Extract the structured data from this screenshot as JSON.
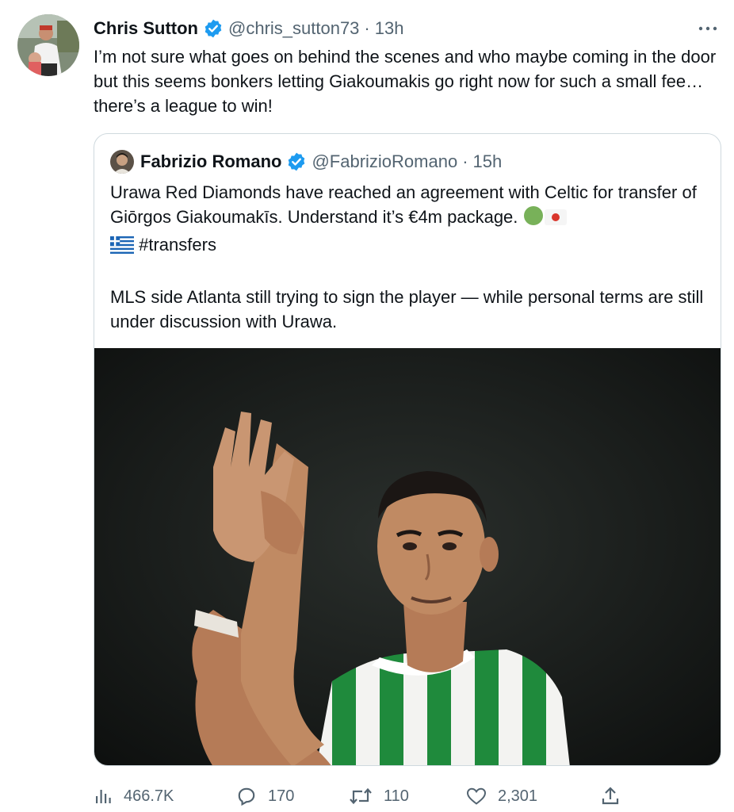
{
  "author": {
    "name": "Chris Sutton",
    "handle": "@chris_sutton73",
    "time": "13h"
  },
  "separator": "·",
  "tweet_text": "I’m not sure what goes on behind the scenes and who maybe coming in the door but this seems bonkers letting Giakoumakis go right now for such a small fee… there’s a league to win!",
  "quoted": {
    "name": "Fabrizio Romano",
    "handle": "@FabrizioRomano",
    "time": "15h",
    "line1": "Urawa Red Diamonds have reached an agreement with Celtic for transfer of Giōrgos Giakoumakīs. Understand it’s €4m package.",
    "hashtag": "#transfers",
    "para2": "MLS side Atlanta still trying to sign the player — while personal terms are still under discussion with Urawa.",
    "emojis": [
      "green-circle",
      "japan-flag",
      "greece-flag"
    ]
  },
  "metrics": {
    "views": "466.7K",
    "replies": "170",
    "retweets": "110",
    "likes": "2,301"
  },
  "colors": {
    "verified": "#1d9bf0",
    "secondary_text": "#536471",
    "border": "#cfd9de",
    "celtic_green": "#1f8a3c"
  },
  "icons": [
    "verified-badge-icon",
    "more-icon",
    "views-icon",
    "reply-icon",
    "retweet-icon",
    "like-icon",
    "share-icon"
  ]
}
